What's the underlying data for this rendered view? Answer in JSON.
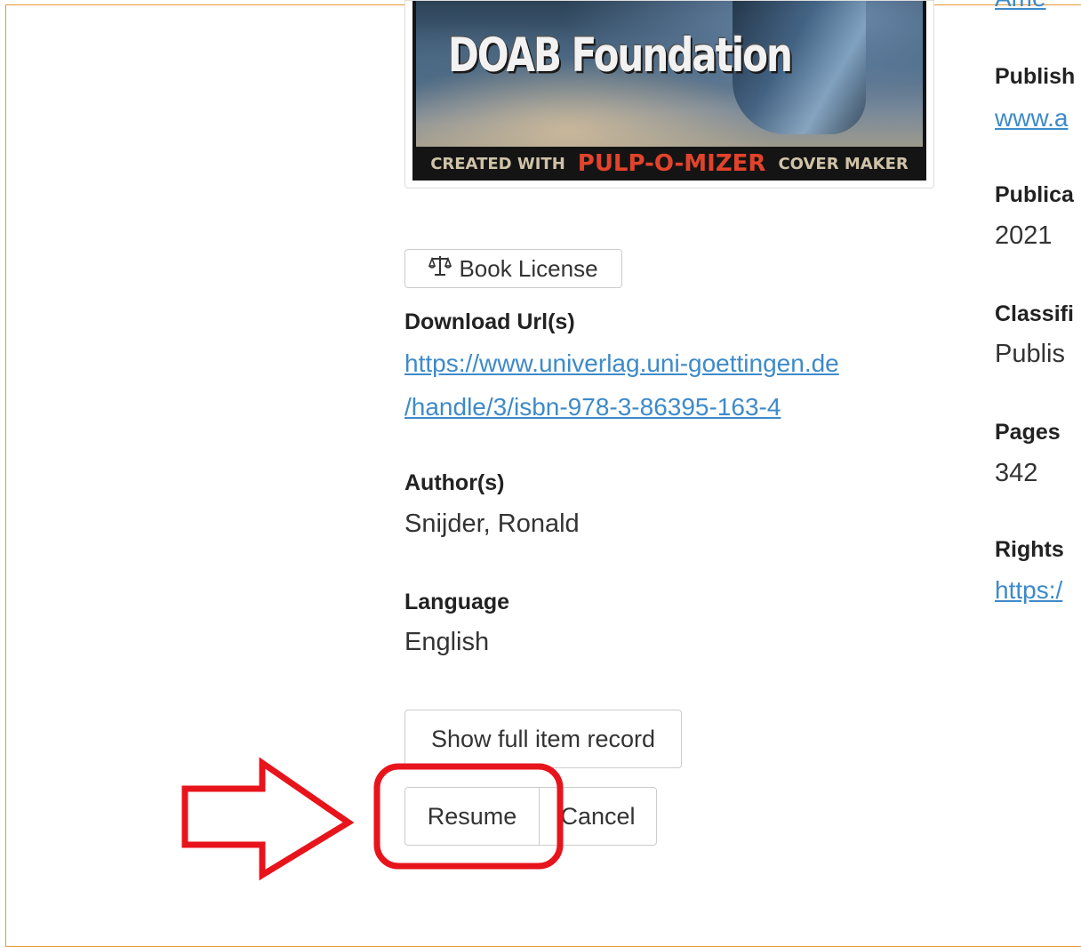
{
  "cover": {
    "title": "DOAB Foundation",
    "footer_left": "CREATED WITH",
    "footer_brand": "PULP-O-MIZER",
    "footer_right": "COVER MAKER"
  },
  "license_button": {
    "icon": "balance-scale-icon",
    "label": "Book License"
  },
  "left_fields": {
    "download_label": "Download Url(s)",
    "download_line1": "https://www.univerlag.uni-goettingen.de",
    "download_line2": "/handle/3/isbn-978-3-86395-163-4",
    "authors_label": "Author(s)",
    "authors_value": "Snijder, Ronald",
    "language_label": "Language",
    "language_value": "English"
  },
  "right_fields": {
    "top_clipped_link": "Ame",
    "publisher_label": "Publish",
    "publisher_link": "www.a",
    "publication_label": "Publica",
    "publication_value": "2021",
    "classification_label": "Classifi",
    "classification_value": "Publis",
    "pages_label": "Pages",
    "pages_value": "342",
    "rights_label": "Rights",
    "rights_link": "https:/"
  },
  "actions": {
    "show_full_record": "Show full item record",
    "resume": "Resume",
    "cancel": "Cancel"
  },
  "annotation": {
    "color": "#e8141c",
    "shape": "arrow-and-rounded-box"
  }
}
